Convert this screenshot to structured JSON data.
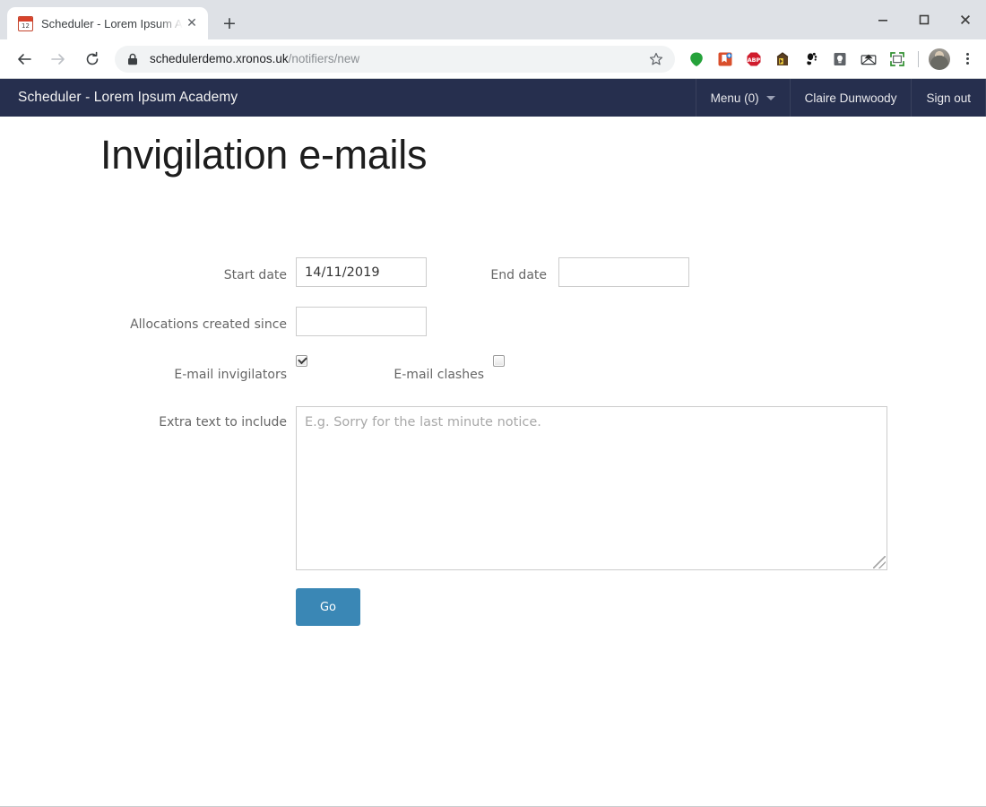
{
  "browser": {
    "tab": {
      "title": "Scheduler - Lorem Ipsum A",
      "favicon_label": "12",
      "close_label": "✕"
    },
    "new_tab_label": "+",
    "window_controls": {
      "minimize": "–",
      "maximize": "□",
      "close": "✕"
    },
    "url": {
      "host": "schedulerdemo.xronos.uk",
      "path": "/notifiers/new"
    },
    "extensions": [
      "green-dot-icon",
      "bookmark-add-icon",
      "adblock-plus-icon",
      "gnome-house-icon",
      "gnome-foot-icon",
      "lightbulb-icon",
      "mail-icon",
      "screenshot-frame-icon"
    ]
  },
  "appbar": {
    "brand": "Scheduler - Lorem Ipsum Academy",
    "menu": "Menu (0)",
    "user": "Claire Dunwoody",
    "signout": "Sign out"
  },
  "page": {
    "title": "Invigilation e-mails"
  },
  "form": {
    "start_date": {
      "label": "Start date",
      "value": "14/11/2019",
      "placeholder": ""
    },
    "end_date": {
      "label": "End date",
      "value": "",
      "placeholder": ""
    },
    "allocations_created_since": {
      "label": "Allocations created since",
      "value": "",
      "placeholder": ""
    },
    "email_invigilators": {
      "label": "E-mail invigilators",
      "checked": true
    },
    "email_clashes": {
      "label": "E-mail clashes",
      "checked": false
    },
    "extra_text": {
      "label": "Extra text to include",
      "value": "",
      "placeholder": "E.g. Sorry for the last minute notice."
    },
    "submit": {
      "label": "Go"
    }
  },
  "colors": {
    "navbar": "#262f4e",
    "button": "#3a87b5",
    "tab_strip": "#dee1e6"
  }
}
